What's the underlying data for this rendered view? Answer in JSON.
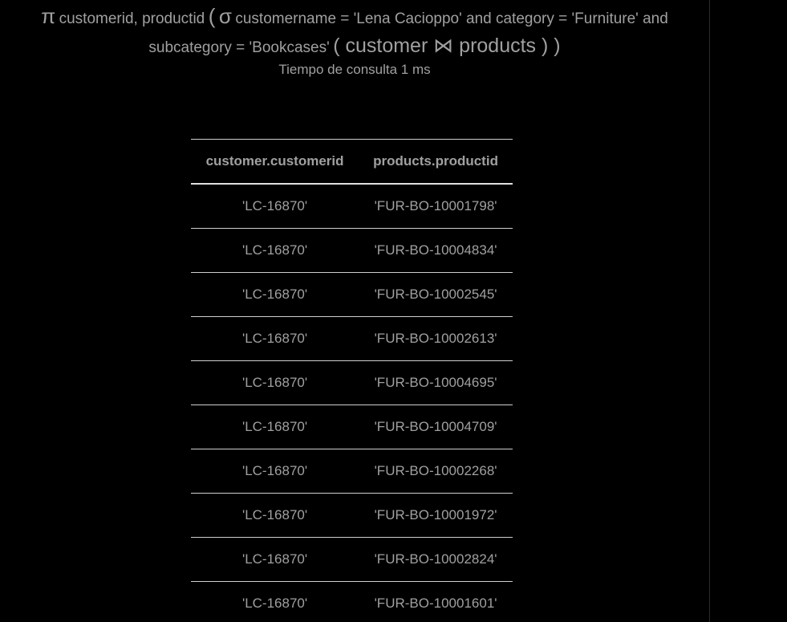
{
  "query": {
    "projection_symbol": "π",
    "projection_attrs": "customerid, productid",
    "open_paren_1": "(",
    "selection_symbol": "σ",
    "selection_cond_line1": "customername = 'Lena Cacioppo' and category = 'Furniture' and",
    "selection_cond_line2": "subcategory = 'Bookcases'",
    "join_expression": "( customer ⋈ products ) )"
  },
  "query_time": "Tiempo de consulta 1 ms",
  "table": {
    "columns": [
      "customer.customerid",
      "products.productid"
    ],
    "rows": [
      [
        "'LC-16870'",
        "'FUR-BO-10001798'"
      ],
      [
        "'LC-16870'",
        "'FUR-BO-10004834'"
      ],
      [
        "'LC-16870'",
        "'FUR-BO-10002545'"
      ],
      [
        "'LC-16870'",
        "'FUR-BO-10002613'"
      ],
      [
        "'LC-16870'",
        "'FUR-BO-10004695'"
      ],
      [
        "'LC-16870'",
        "'FUR-BO-10004709'"
      ],
      [
        "'LC-16870'",
        "'FUR-BO-10002268'"
      ],
      [
        "'LC-16870'",
        "'FUR-BO-10001972'"
      ],
      [
        "'LC-16870'",
        "'FUR-BO-10002824'"
      ],
      [
        "'LC-16870'",
        "'FUR-BO-10001601'"
      ]
    ]
  }
}
